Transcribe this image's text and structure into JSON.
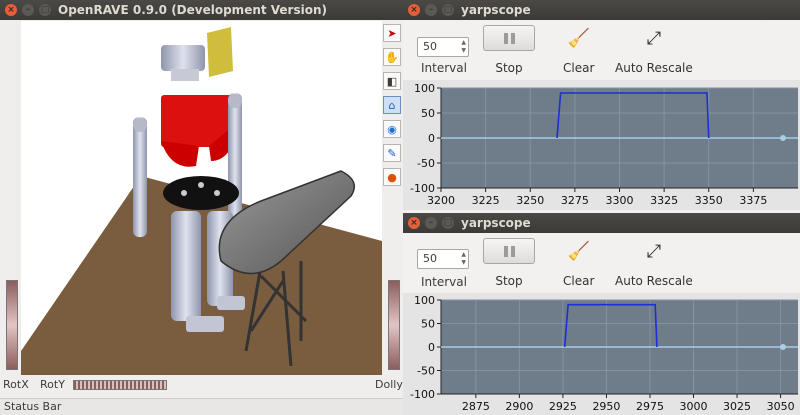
{
  "openrave": {
    "title": "OpenRAVE 0.9.0 (Development Version)",
    "labels": {
      "rotx": "RotX",
      "roty": "RotY",
      "dolly": "Dolly"
    },
    "status_bar": "Status Bar",
    "tools": [
      "select-arrow-icon",
      "hand-pan-icon",
      "camera-view-icon",
      "camera-home-icon",
      "eye-icon",
      "pencil-icon",
      "record-icon"
    ]
  },
  "scopes": [
    {
      "title": "yarpscope",
      "interval_value": "50",
      "interval_label": "Interval",
      "stop_label": "Stop",
      "clear_label": "Clear",
      "auto_rescale_label": "Auto Rescale",
      "y_ticks": [
        "100",
        "50",
        "0",
        "-50",
        "-100"
      ],
      "x_ticks": [
        "3200",
        "3225",
        "3250",
        "3275",
        "3300",
        "3325",
        "3350",
        "3375"
      ]
    },
    {
      "title": "yarpscope",
      "interval_value": "50",
      "interval_label": "Interval",
      "stop_label": "Stop",
      "clear_label": "Clear",
      "auto_rescale_label": "Auto Rescale",
      "y_ticks": [
        "100",
        "50",
        "0",
        "-50",
        "-100"
      ],
      "x_ticks": [
        "2875",
        "2900",
        "2925",
        "2950",
        "2975",
        "3000",
        "3025",
        "3050"
      ]
    }
  ],
  "colors": {
    "plot_bg": "#6f7c8a",
    "signal": "#1b2fd6",
    "zero_line": "#a9cde6",
    "floor": "#7a5c3e",
    "robot_red": "#dd1010"
  },
  "chart_data": [
    {
      "type": "line",
      "x_range": [
        3200,
        3400
      ],
      "ylim": [
        -100,
        100
      ],
      "grid": true,
      "series": [
        {
          "x": [
            3200,
            3265,
            3267,
            3349,
            3350,
            3400
          ],
          "values": [
            0,
            0,
            90,
            90,
            0,
            0
          ]
        }
      ]
    },
    {
      "type": "line",
      "x_range": [
        2855,
        3060
      ],
      "ylim": [
        -100,
        100
      ],
      "grid": true,
      "series": [
        {
          "x": [
            2855,
            2926,
            2928,
            2978,
            2979,
            3060
          ],
          "values": [
            0,
            0,
            90,
            90,
            0,
            0
          ]
        }
      ]
    }
  ]
}
